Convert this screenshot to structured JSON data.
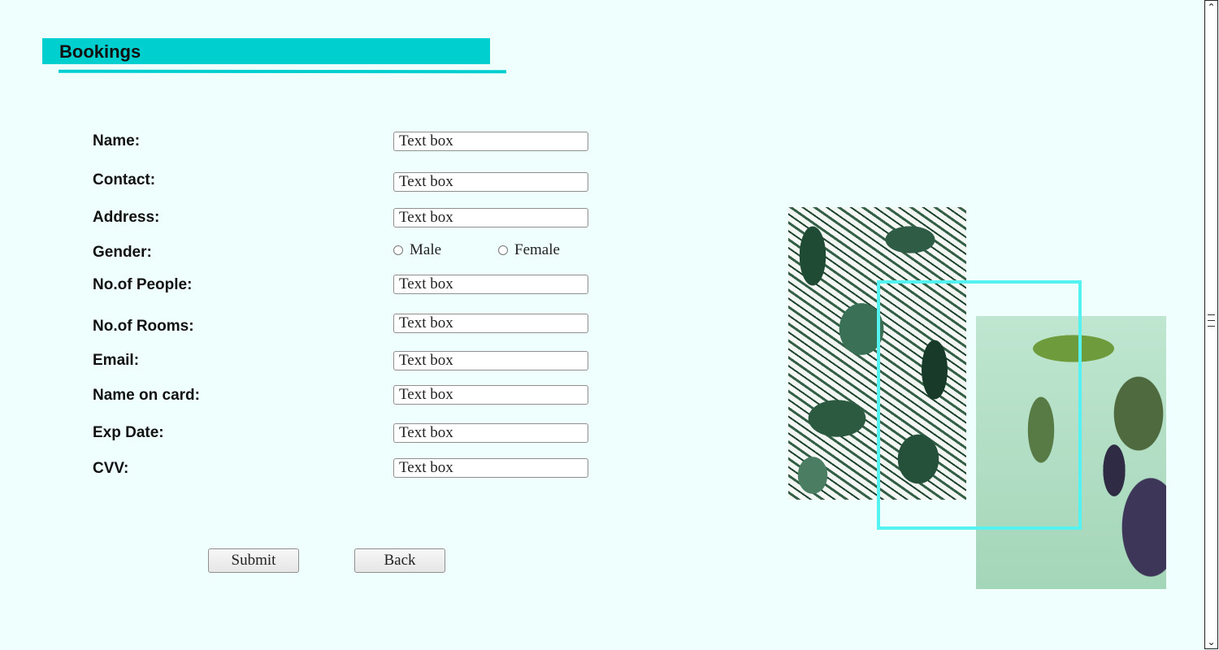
{
  "header": {
    "title": "Bookings"
  },
  "form": {
    "fields": [
      {
        "label": "Name:",
        "value": "Text box"
      },
      {
        "label": "Contact:",
        "value": "Text box"
      },
      {
        "label": "Address:",
        "value": "Text box"
      },
      {
        "label": "No.of People:",
        "value": "Text box"
      },
      {
        "label": "No.of Rooms:",
        "value": "Text box"
      },
      {
        "label": "Email:",
        "value": "Text box"
      },
      {
        "label": "Name on card:",
        "value": "Text box"
      },
      {
        "label": "Exp Date:",
        "value": "Text box"
      },
      {
        "label": "CVV:",
        "value": "Text box"
      }
    ],
    "gender": {
      "label": "Gender:",
      "options": [
        "Male",
        "Female"
      ]
    }
  },
  "buttons": {
    "submit": "Submit",
    "back": "Back"
  },
  "colors": {
    "background": "#eefffe",
    "accent": "#00cfcf",
    "frame": "#55f2f2"
  },
  "images": [
    "tropical-leaves-image",
    "palm-tree-image"
  ]
}
